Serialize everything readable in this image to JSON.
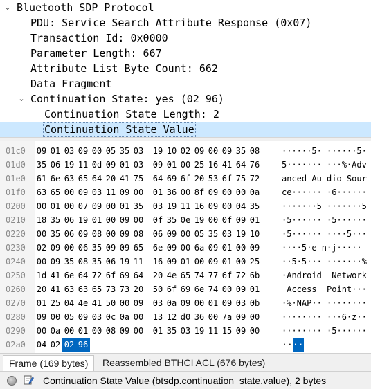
{
  "tree": [
    {
      "label": "Bluetooth SDP Protocol",
      "arrow": "⌄",
      "indent": 0
    },
    {
      "label": "PDU: Service Search Attribute Response (0x07)",
      "arrow": "",
      "indent": 1
    },
    {
      "label": "Transaction Id: 0x0000",
      "arrow": "",
      "indent": 1
    },
    {
      "label": "Parameter Length: 667",
      "arrow": "",
      "indent": 1
    },
    {
      "label": "Attribute List Byte Count: 662",
      "arrow": "",
      "indent": 1
    },
    {
      "label": "Data Fragment",
      "arrow": "",
      "indent": 1
    },
    {
      "label": "Continuation State: yes (02 96)",
      "arrow": "⌄",
      "indent": 1
    },
    {
      "label": "Continuation State Length: 2",
      "arrow": "",
      "indent": 2
    },
    {
      "label": "Continuation State Value",
      "arrow": "",
      "indent": 2,
      "selected": true
    }
  ],
  "hex_rows": [
    {
      "offset": "01c0",
      "bytes": [
        "09",
        "01",
        "03",
        "09",
        "00",
        "05",
        "35",
        "03",
        "19",
        "10",
        "02",
        "09",
        "00",
        "09",
        "35",
        "08"
      ],
      "ascii": "······5· ······5·"
    },
    {
      "offset": "01d0",
      "bytes": [
        "35",
        "06",
        "19",
        "11",
        "0d",
        "09",
        "01",
        "03",
        "09",
        "01",
        "00",
        "25",
        "16",
        "41",
        "64",
        "76"
      ],
      "ascii": "5······· ···%·Adv"
    },
    {
      "offset": "01e0",
      "bytes": [
        "61",
        "6e",
        "63",
        "65",
        "64",
        "20",
        "41",
        "75",
        "64",
        "69",
        "6f",
        "20",
        "53",
        "6f",
        "75",
        "72"
      ],
      "ascii": "anced Au dio Sour"
    },
    {
      "offset": "01f0",
      "bytes": [
        "63",
        "65",
        "00",
        "09",
        "03",
        "11",
        "09",
        "00",
        "01",
        "36",
        "00",
        "8f",
        "09",
        "00",
        "00",
        "0a"
      ],
      "ascii": "ce······ ·6······"
    },
    {
      "offset": "0200",
      "bytes": [
        "00",
        "01",
        "00",
        "07",
        "09",
        "00",
        "01",
        "35",
        "03",
        "19",
        "11",
        "16",
        "09",
        "00",
        "04",
        "35"
      ],
      "ascii": "·······5 ·······5"
    },
    {
      "offset": "0210",
      "bytes": [
        "18",
        "35",
        "06",
        "19",
        "01",
        "00",
        "09",
        "00",
        "0f",
        "35",
        "0e",
        "19",
        "00",
        "0f",
        "09",
        "01"
      ],
      "ascii": "·5······ ·5······"
    },
    {
      "offset": "0220",
      "bytes": [
        "00",
        "35",
        "06",
        "09",
        "08",
        "00",
        "09",
        "08",
        "06",
        "09",
        "00",
        "05",
        "35",
        "03",
        "19",
        "10"
      ],
      "ascii": "·5······ ····5···"
    },
    {
      "offset": "0230",
      "bytes": [
        "02",
        "09",
        "00",
        "06",
        "35",
        "09",
        "09",
        "65",
        "6e",
        "09",
        "00",
        "6a",
        "09",
        "01",
        "00",
        "09"
      ],
      "ascii": "····5·e n·j·····"
    },
    {
      "offset": "0240",
      "bytes": [
        "00",
        "09",
        "35",
        "08",
        "35",
        "06",
        "19",
        "11",
        "16",
        "09",
        "01",
        "00",
        "09",
        "01",
        "00",
        "25"
      ],
      "ascii": "··5·5··· ·······%"
    },
    {
      "offset": "0250",
      "bytes": [
        "1d",
        "41",
        "6e",
        "64",
        "72",
        "6f",
        "69",
        "64",
        "20",
        "4e",
        "65",
        "74",
        "77",
        "6f",
        "72",
        "6b"
      ],
      "ascii": "·Android  Network"
    },
    {
      "offset": "0260",
      "bytes": [
        "20",
        "41",
        "63",
        "63",
        "65",
        "73",
        "73",
        "20",
        "50",
        "6f",
        "69",
        "6e",
        "74",
        "00",
        "09",
        "01"
      ],
      "ascii": " Access  Point···"
    },
    {
      "offset": "0270",
      "bytes": [
        "01",
        "25",
        "04",
        "4e",
        "41",
        "50",
        "00",
        "09",
        "03",
        "0a",
        "09",
        "00",
        "01",
        "09",
        "03",
        "0b"
      ],
      "ascii": "·%·NAP·· ········"
    },
    {
      "offset": "0280",
      "bytes": [
        "09",
        "00",
        "05",
        "09",
        "03",
        "0c",
        "0a",
        "00",
        "13",
        "12",
        "d0",
        "36",
        "00",
        "7a",
        "09",
        "00"
      ],
      "ascii": "········ ···6·z··"
    },
    {
      "offset": "0290",
      "bytes": [
        "00",
        "0a",
        "00",
        "01",
        "00",
        "08",
        "09",
        "00",
        "01",
        "35",
        "03",
        "19",
        "11",
        "15",
        "09",
        "00"
      ],
      "ascii": "········ ·5······"
    },
    {
      "offset": "02a0",
      "bytes": [
        "04",
        "02",
        "02",
        "96"
      ],
      "ascii": "····",
      "highlight_bytes": [
        2,
        3
      ],
      "highlight_ascii": [
        2,
        3
      ]
    }
  ],
  "tabs": [
    {
      "label": "Frame (169 bytes)",
      "active": true
    },
    {
      "label": "Reassembled BTHCI ACL (676 bytes)",
      "active": false
    }
  ],
  "status": {
    "text": "Continuation State Value (btsdp.continuation_state.value), 2 bytes",
    "light_icon": "status-light-icon",
    "edit_icon": "edit-comment-icon"
  }
}
